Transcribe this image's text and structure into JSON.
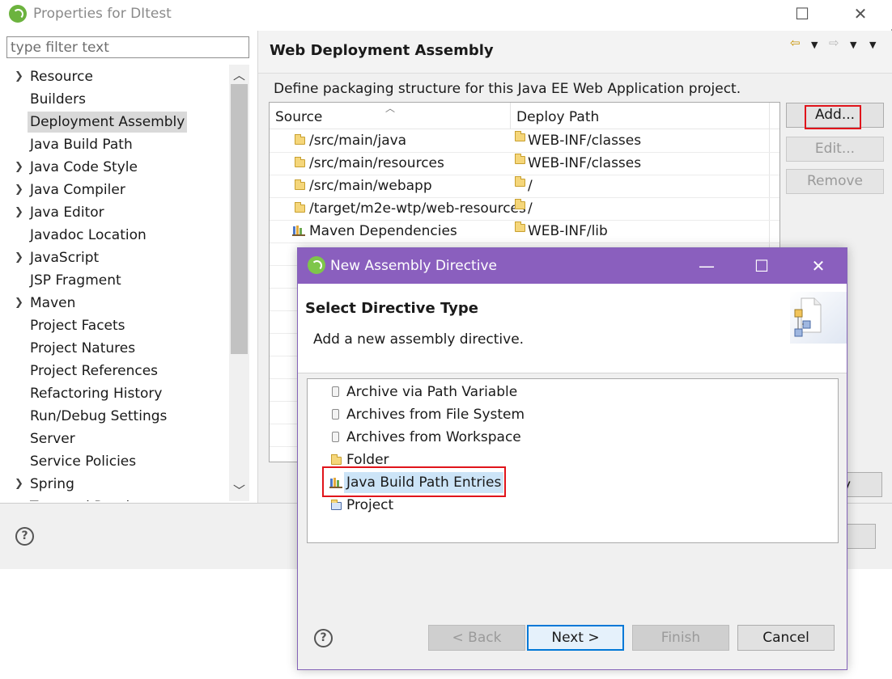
{
  "properties_window": {
    "title": "Properties for DItest",
    "filter_placeholder": "type filter text",
    "nav_items": [
      {
        "label": "Resource",
        "expandable": true
      },
      {
        "label": "Builders",
        "expandable": false
      },
      {
        "label": "Deployment Assembly",
        "expandable": false,
        "selected": true
      },
      {
        "label": "Java Build Path",
        "expandable": false
      },
      {
        "label": "Java Code Style",
        "expandable": true
      },
      {
        "label": "Java Compiler",
        "expandable": true
      },
      {
        "label": "Java Editor",
        "expandable": true
      },
      {
        "label": "Javadoc Location",
        "expandable": false
      },
      {
        "label": "JavaScript",
        "expandable": true
      },
      {
        "label": "JSP Fragment",
        "expandable": false
      },
      {
        "label": "Maven",
        "expandable": true
      },
      {
        "label": "Project Facets",
        "expandable": false
      },
      {
        "label": "Project Natures",
        "expandable": false
      },
      {
        "label": "Project References",
        "expandable": false
      },
      {
        "label": "Refactoring History",
        "expandable": false
      },
      {
        "label": "Run/Debug Settings",
        "expandable": false
      },
      {
        "label": "Server",
        "expandable": false
      },
      {
        "label": "Service Policies",
        "expandable": false
      },
      {
        "label": "Spring",
        "expandable": true
      },
      {
        "label": "Targeted Runtimes",
        "expandable": false
      }
    ],
    "page": {
      "title": "Web Deployment Assembly",
      "description": "Define packaging structure for this Java EE Web Application project.",
      "table": {
        "columns": [
          "Source",
          "Deploy Path"
        ],
        "rows": [
          {
            "source": "/src/main/java",
            "deploy": "WEB-INF/classes",
            "icon": "folder-icon"
          },
          {
            "source": "/src/main/resources",
            "deploy": "WEB-INF/classes",
            "icon": "folder-icon"
          },
          {
            "source": "/src/main/webapp",
            "deploy": "/",
            "icon": "folder-icon"
          },
          {
            "source": "/target/m2e-wtp/web-resources",
            "deploy": "/",
            "icon": "folder-icon"
          },
          {
            "source": "Maven Dependencies",
            "deploy": "WEB-INF/lib",
            "icon": "library-icon"
          }
        ]
      },
      "buttons": {
        "add": "Add...",
        "edit": "Edit...",
        "remove": "Remove",
        "apply_tail": "y"
      }
    },
    "colors": {
      "highlight_red": "#e0141b",
      "dialog_title_purple": "#8a5fbe",
      "selection_blue": "#cce4f7"
    }
  },
  "dialog": {
    "title": "New Assembly Directive",
    "heading": "Select Directive Type",
    "description": "Add a new assembly directive.",
    "items": [
      {
        "label": "Archive via Path Variable",
        "icon": "jar-icon"
      },
      {
        "label": "Archives from File System",
        "icon": "jar-icon"
      },
      {
        "label": "Archives from Workspace",
        "icon": "jar-icon"
      },
      {
        "label": "Folder",
        "icon": "folder-icon"
      },
      {
        "label": "Java Build Path Entries",
        "icon": "library-icon",
        "selected": true
      },
      {
        "label": "Project",
        "icon": "project-icon"
      }
    ],
    "buttons": {
      "back": "< Back",
      "next": "Next >",
      "finish": "Finish",
      "cancel": "Cancel"
    }
  }
}
